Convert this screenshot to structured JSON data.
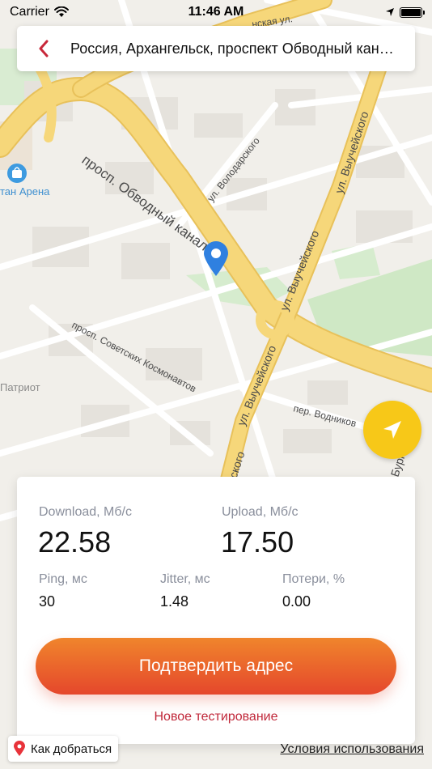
{
  "status_bar": {
    "carrier": "Carrier",
    "time": "11:46 AM"
  },
  "address_bar": {
    "text": "Россия, Архангельск, проспект Обводный канал"
  },
  "map": {
    "labels": {
      "obvodny": "просп. Обводный канал",
      "volodarsky": "ул. Володарского",
      "vychegodskogo_top": "ул. Выучейского",
      "vychegodskogo_mid": "ул. Выучейского",
      "vychegodskogo_low": "ул. Выучейского",
      "vychegodskogo_bottom": "ул. Выучейского",
      "sovetskikh": "просп. Советских Космонавтов",
      "vodnikov": "пер. Водников",
      "arena": "тан Арена",
      "patriot": "Патриот",
      "top_street": "нская ул.",
      "right_edge": "Бург"
    }
  },
  "results": {
    "download_label": "Download, Мб/с",
    "download_value": "22.58",
    "upload_label": "Upload, Мб/с",
    "upload_value": "17.50",
    "ping_label": "Ping, мс",
    "ping_value": "30",
    "jitter_label": "Jitter, мс",
    "jitter_value": "1.48",
    "loss_label": "Потери, %",
    "loss_value": "0.00"
  },
  "actions": {
    "confirm_label": "Подтвердить адрес",
    "new_test_label": "Новое тестирование"
  },
  "footer": {
    "route_label": "Как добраться",
    "terms_label": "Условия использования"
  },
  "colors": {
    "accent_red": "#c8283a",
    "button_gradient_top": "#f0852c",
    "button_gradient_bottom": "#e5472c",
    "locate_yellow": "#f7c818",
    "pin_blue": "#2f80e0",
    "road_main": "#f6d77a"
  },
  "icons": {
    "back": "chevron-left-icon",
    "locate": "navigation-arrow-icon",
    "pin": "map-pin-icon",
    "route": "yandex-pin-icon",
    "wifi": "wifi-icon",
    "location": "location-arrow-icon",
    "battery": "battery-icon",
    "shop": "shopping-bag-icon"
  }
}
